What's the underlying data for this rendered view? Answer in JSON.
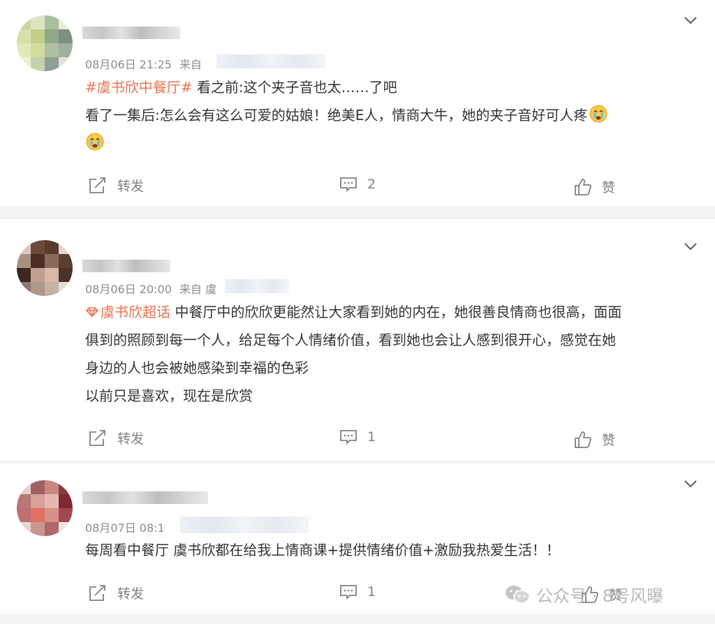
{
  "comments": [
    {
      "timestamp": "08月06日 21:25",
      "source_label": "来自",
      "topic_tag": "#虞书欣中餐厅#",
      "lines": [
        " 看之前:这个夹子音也太……了吧",
        "看了一集后:怎么会有这么可爱的姑娘！绝美E人，情商大牛，她的夹子音好可人疼"
      ],
      "emoji": "crying-face",
      "repost_label": "转发",
      "comment_count": "2",
      "like_label": "赞"
    },
    {
      "timestamp": "08月06日 20:00",
      "source_label": "来自 虞",
      "topic_tag": "虞书欣超话",
      "lines": [
        " 中餐厅中的欣欣更能然让大家看到她的内在，她很善良情商也很高，面面",
        "俱到的照顾到每一个人，给足每个人情绪价值，看到她也会让人感到很开心，感觉在她",
        "身边的人也会被她感染到幸福的色彩",
        "以前只是喜欢，现在是欣赏"
      ],
      "repost_label": "转发",
      "comment_count": "1",
      "like_label": "赞"
    },
    {
      "timestamp": "08月07日 08:1",
      "lines": [
        "每周看中餐厅 虞书欣都在给我上情商课+提供情绪价值+激励我热爱生活！！"
      ],
      "repost_label": "转发",
      "comment_count": "1",
      "like_label": "赞"
    }
  ],
  "watermark": {
    "text": "公众号 · 8号风曝"
  },
  "colors": {
    "tag": "#eb7350",
    "text": "#333333",
    "meta": "#8b8b8b",
    "separator": "#f2f2f2"
  }
}
